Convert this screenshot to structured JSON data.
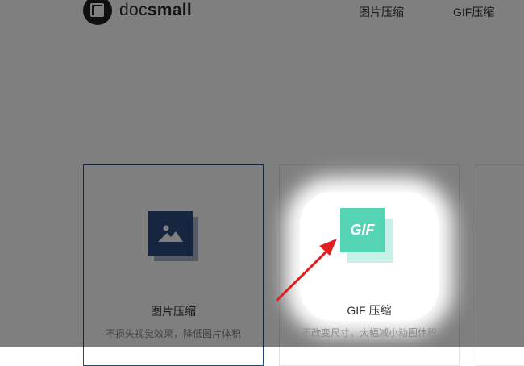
{
  "logo": {
    "text_prefix": "doc",
    "text_suffix": "small"
  },
  "nav": {
    "items": [
      {
        "label": "图片压缩"
      },
      {
        "label": "GIF压缩"
      }
    ]
  },
  "cards": [
    {
      "title": "图片压缩",
      "desc": "不损失视觉效果，降低图片体积",
      "icon": "image-icon"
    },
    {
      "title": "GIF 压缩",
      "desc": "不改变尺寸，大幅减小动图体积",
      "icon": "gif-icon",
      "icon_text": "GIF"
    }
  ],
  "colors": {
    "image_icon": "#2c4a80",
    "gif_icon": "#55d4b4",
    "annotation_arrow": "#e02020"
  }
}
